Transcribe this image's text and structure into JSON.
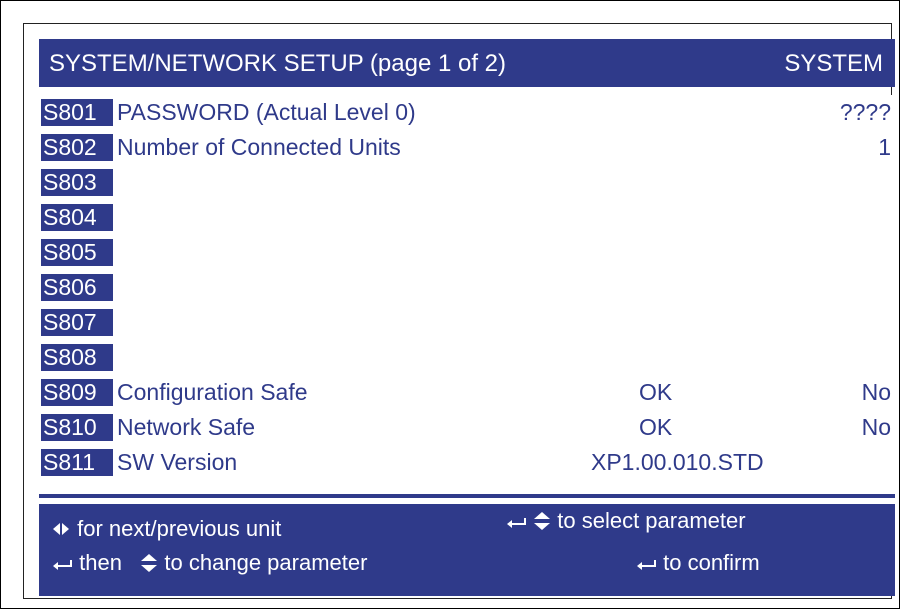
{
  "header": {
    "title": "SYSTEM/NETWORK SETUP (page 1 of 2)",
    "mode": "SYSTEM"
  },
  "rows": [
    {
      "code": "S801",
      "label": "PASSWORD  (Actual Level  0)",
      "status": "",
      "value": "????"
    },
    {
      "code": "S802",
      "label": "Number of Connected Units",
      "status": "",
      "value": "1"
    },
    {
      "code": "S803",
      "label": "",
      "status": "",
      "value": ""
    },
    {
      "code": "S804",
      "label": "",
      "status": "",
      "value": ""
    },
    {
      "code": "S805",
      "label": "",
      "status": "",
      "value": ""
    },
    {
      "code": "S806",
      "label": "",
      "status": "",
      "value": ""
    },
    {
      "code": "S807",
      "label": "",
      "status": "",
      "value": ""
    },
    {
      "code": "S808",
      "label": "",
      "status": "",
      "value": ""
    },
    {
      "code": "S809",
      "label": "Configuration Safe",
      "status": "OK",
      "value": "No"
    },
    {
      "code": "S810",
      "label": "Network Safe",
      "status": "OK",
      "value": "No"
    },
    {
      "code": "S811",
      "label": "SW Version",
      "status": "XP1.00.010.STD",
      "value": ""
    }
  ],
  "footer": {
    "next_prev": "for next/previous unit",
    "select_param": "to select parameter",
    "then": "then",
    "change_param": "to change parameter",
    "confirm": "to confirm"
  },
  "icons": {
    "left_right": "left-right-arrows-icon",
    "enter": "enter-icon",
    "up_down": "up-down-arrows-icon"
  },
  "colors": {
    "panel": "#2f3a8a",
    "text_on_white": "#2f3a8a",
    "text_on_panel": "#ffffff"
  }
}
